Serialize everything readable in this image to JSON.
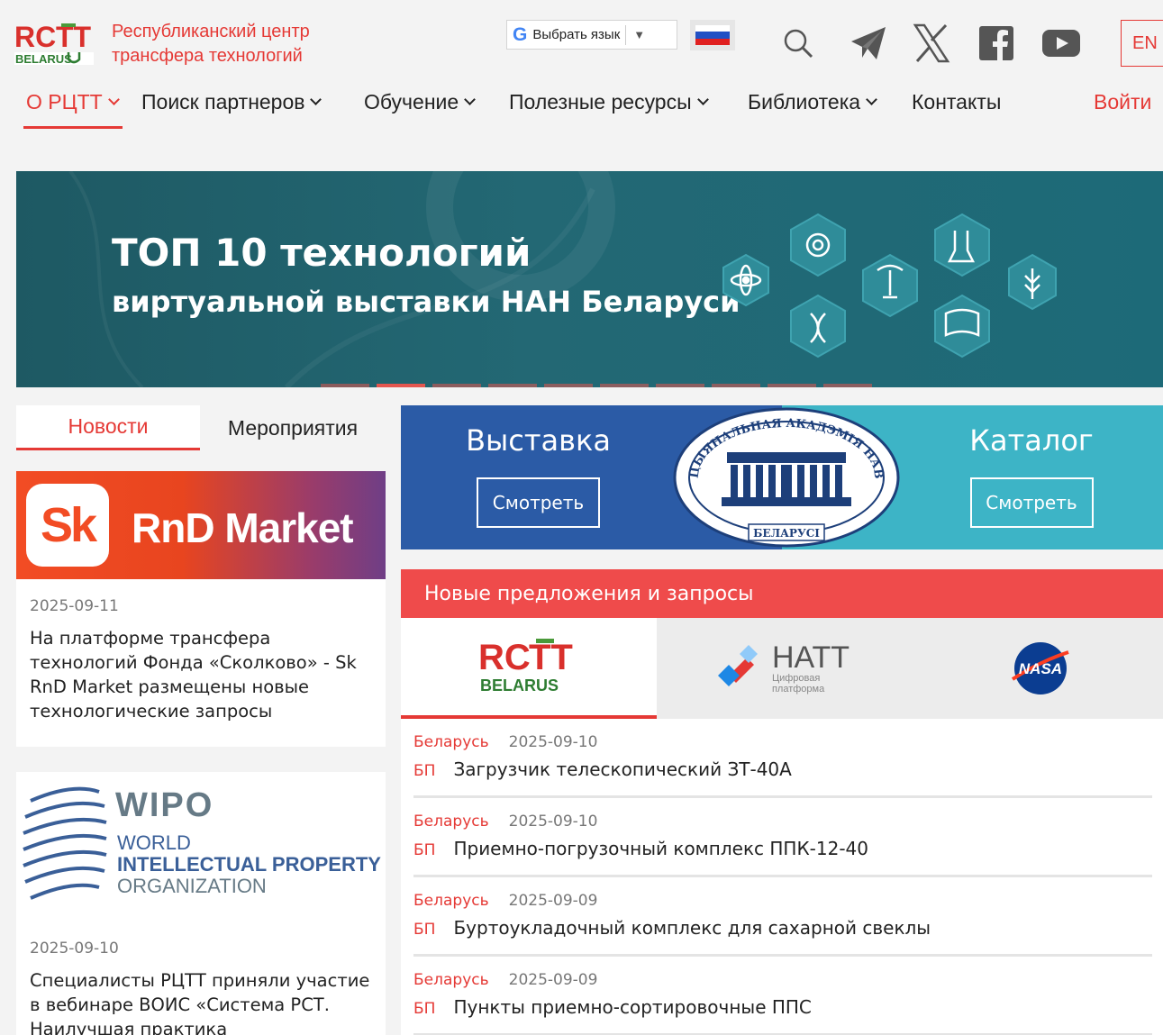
{
  "header": {
    "logo_text": "RCTT BELARUS",
    "org_line1": "Республиканский центр",
    "org_line2": "трансфера технологий",
    "language_widget_label": "Выбрать язык",
    "en_button": "EN",
    "icons": [
      "search-icon",
      "telegram-icon",
      "x-icon",
      "facebook-icon",
      "youtube-icon"
    ]
  },
  "nav": {
    "items": [
      {
        "label": "О РЦТТ",
        "has_dropdown": true,
        "active": true
      },
      {
        "label": "Поиск партнеров",
        "has_dropdown": true
      },
      {
        "label": "Обучение",
        "has_dropdown": true
      },
      {
        "label": "Полезные ресурсы",
        "has_dropdown": true
      },
      {
        "label": "Библиотека",
        "has_dropdown": true
      },
      {
        "label": "Контакты",
        "has_dropdown": false
      }
    ],
    "login": "Войти"
  },
  "banner": {
    "title": "ТОП 10 технологий",
    "subtitle": "виртуальной выставки НАН Беларуси",
    "slides_count": 10,
    "active_slide": 2
  },
  "news_tabs": {
    "active": "Новости",
    "other": "Мероприятия"
  },
  "news": [
    {
      "image_logo": "Sk",
      "image_text": "RnD Market",
      "date": "2025-09-11",
      "text": "На платформе трансфера технологий Фонда «Сколково» - Sk RnD Market размещены новые технологические запросы"
    },
    {
      "image_logo": "WIPO",
      "image_line1": "WORLD",
      "image_line2": "INTELLECTUAL PROPERTY",
      "image_line3": "ORGANIZATION",
      "date": "2025-09-10",
      "text": "Специалисты РЦТТ приняли участие в вебинаре ВОИС «Система РСТ. Наилучшая практика"
    }
  ],
  "expo": {
    "left_title": "Выставка",
    "left_button": "Смотреть",
    "right_title": "Каталог",
    "right_button": "Смотреть",
    "seal_top_text": "НАЦЫЯНАЛЬНАЯ АКАДЭМІЯ НАВУК",
    "seal_bottom_text": "БЕЛАРУСІ"
  },
  "offers": {
    "header": "Новые предложения и запросы",
    "partners": [
      {
        "name": "RCTT BELARUS",
        "active": true
      },
      {
        "name": "НАТТ",
        "caption_line1": "Цифровая",
        "caption_line2": "платформа"
      },
      {
        "name": "NASA"
      }
    ],
    "items": [
      {
        "country": "Беларусь",
        "date": "2025-09-10",
        "code": "БП",
        "title": "Загрузчик телескопический ЗТ-40А"
      },
      {
        "country": "Беларусь",
        "date": "2025-09-10",
        "code": "БП",
        "title": "Приемно-погрузочный комплекс ППК-12-40"
      },
      {
        "country": "Беларусь",
        "date": "2025-09-09",
        "code": "БП",
        "title": "Буртоукладочный комплекс для сахарной свеклы"
      },
      {
        "country": "Беларусь",
        "date": "2025-09-09",
        "code": "БП",
        "title": "Пункты приемно-сортировочные ППС"
      }
    ]
  },
  "colors": {
    "accent": "#e53935",
    "banner_bg": "#236874",
    "expo_left": "#2b5ba6",
    "expo_right": "#3db4c6",
    "offers_header": "#ef4b4b"
  }
}
